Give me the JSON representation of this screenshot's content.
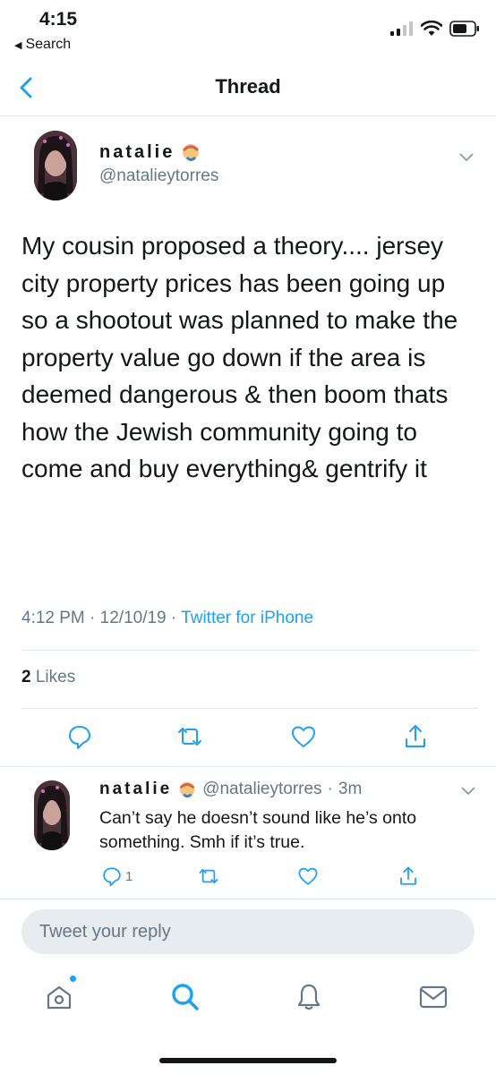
{
  "status": {
    "time": "4:15",
    "back_label": "Search"
  },
  "nav": {
    "title": "Thread"
  },
  "main_tweet": {
    "display_name": "natalie",
    "handle": "@natalieytorres",
    "text": "My cousin proposed a theory.... jersey city property prices has been going up so a shootout was planned to make the property value go down if the area is deemed dangerous & then boom thats how the Jewish community going to come and buy everything& gentrify it",
    "time": "4:12 PM",
    "date": "12/10/19",
    "source": "Twitter for iPhone",
    "likes_count": "2",
    "likes_label": "Likes"
  },
  "reply": {
    "display_name": "natalie",
    "handle": "@natalieytorres",
    "age": "3m",
    "text": "Can’t say he doesn’t sound like he’s onto something. Smh if it’s true.",
    "reply_count": "1"
  },
  "compose": {
    "placeholder": "Tweet your reply"
  },
  "colors": {
    "accent": "#1da1f2",
    "secondary_text": "#657786",
    "divider": "#e1e8ed"
  },
  "icons": [
    "signal-icon",
    "wifi-icon",
    "battery-icon",
    "back-chevron-icon",
    "caret-down-icon",
    "emoji-badge-icon",
    "reply-icon",
    "retweet-icon",
    "like-icon",
    "share-icon",
    "home-icon",
    "search-icon",
    "notifications-icon",
    "messages-icon"
  ]
}
